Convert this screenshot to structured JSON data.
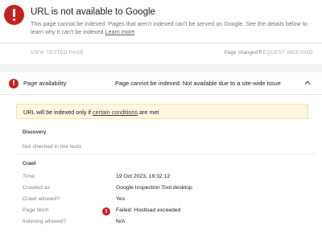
{
  "summary": {
    "title": "URL is not available to Google",
    "description_text": "This page cannot be indexed. Pages that aren't indexed can't be served on Google. See the details below to learn why it can't be indexed ",
    "learn_more": "Learn more",
    "view_tested_page": "VIEW TESTED PAGE",
    "page_changed": "Page changed?",
    "request_indexing": "REQUEST INDEXING"
  },
  "availability": {
    "label": "Page availability",
    "status": "Page cannot be indexed: Not available due to a site-wide issue",
    "notice_prefix": "URL will be indexed only if ",
    "notice_link": "certain conditions",
    "notice_suffix": " are met"
  },
  "discovery": {
    "title": "Discovery",
    "note": "Not checked in live tests"
  },
  "crawl": {
    "title": "Crawl",
    "rows": [
      {
        "label": "Time",
        "value": "19 Oct 2023, 19:32:12"
      },
      {
        "label": "Crawled as",
        "value": "Google Inspection Tool desktop"
      },
      {
        "label": "Crawl allowed?",
        "value": "Yes"
      },
      {
        "label": "Page fetch",
        "value": "Failed: Hostload exceeded"
      },
      {
        "label": "Indexing allowed?",
        "value": "N/A"
      }
    ]
  },
  "colors": {
    "error": "#c5221f",
    "notice_bg": "#fef7e0",
    "muted_text": "#80868b"
  },
  "icons": {
    "top": "error-circle-icon",
    "availability": "error-circle-icon",
    "chevron": "chevron-up-icon",
    "page_fetch": "error-circle-icon"
  }
}
